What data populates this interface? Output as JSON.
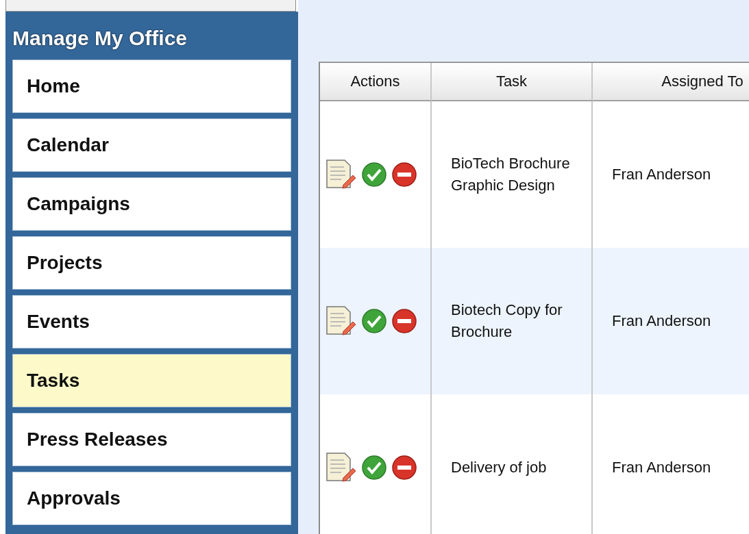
{
  "sidebar": {
    "title": "Manage My Office",
    "items": [
      {
        "label": "Home",
        "selected": false
      },
      {
        "label": "Calendar",
        "selected": false
      },
      {
        "label": "Campaigns",
        "selected": false
      },
      {
        "label": "Projects",
        "selected": false
      },
      {
        "label": "Events",
        "selected": false
      },
      {
        "label": "Tasks",
        "selected": true
      },
      {
        "label": "Press Releases",
        "selected": false
      },
      {
        "label": "Approvals",
        "selected": false
      }
    ]
  },
  "table": {
    "columns": [
      "Actions",
      "Task",
      "Assigned To"
    ],
    "rows": [
      {
        "task": "BioTech Brochure Graphic Design",
        "assigned_to": "Fran Anderson"
      },
      {
        "task": "Biotech Copy for Brochure",
        "assigned_to": "Fran Anderson"
      },
      {
        "task": "Delivery of job",
        "assigned_to": "Fran Anderson"
      }
    ]
  }
}
